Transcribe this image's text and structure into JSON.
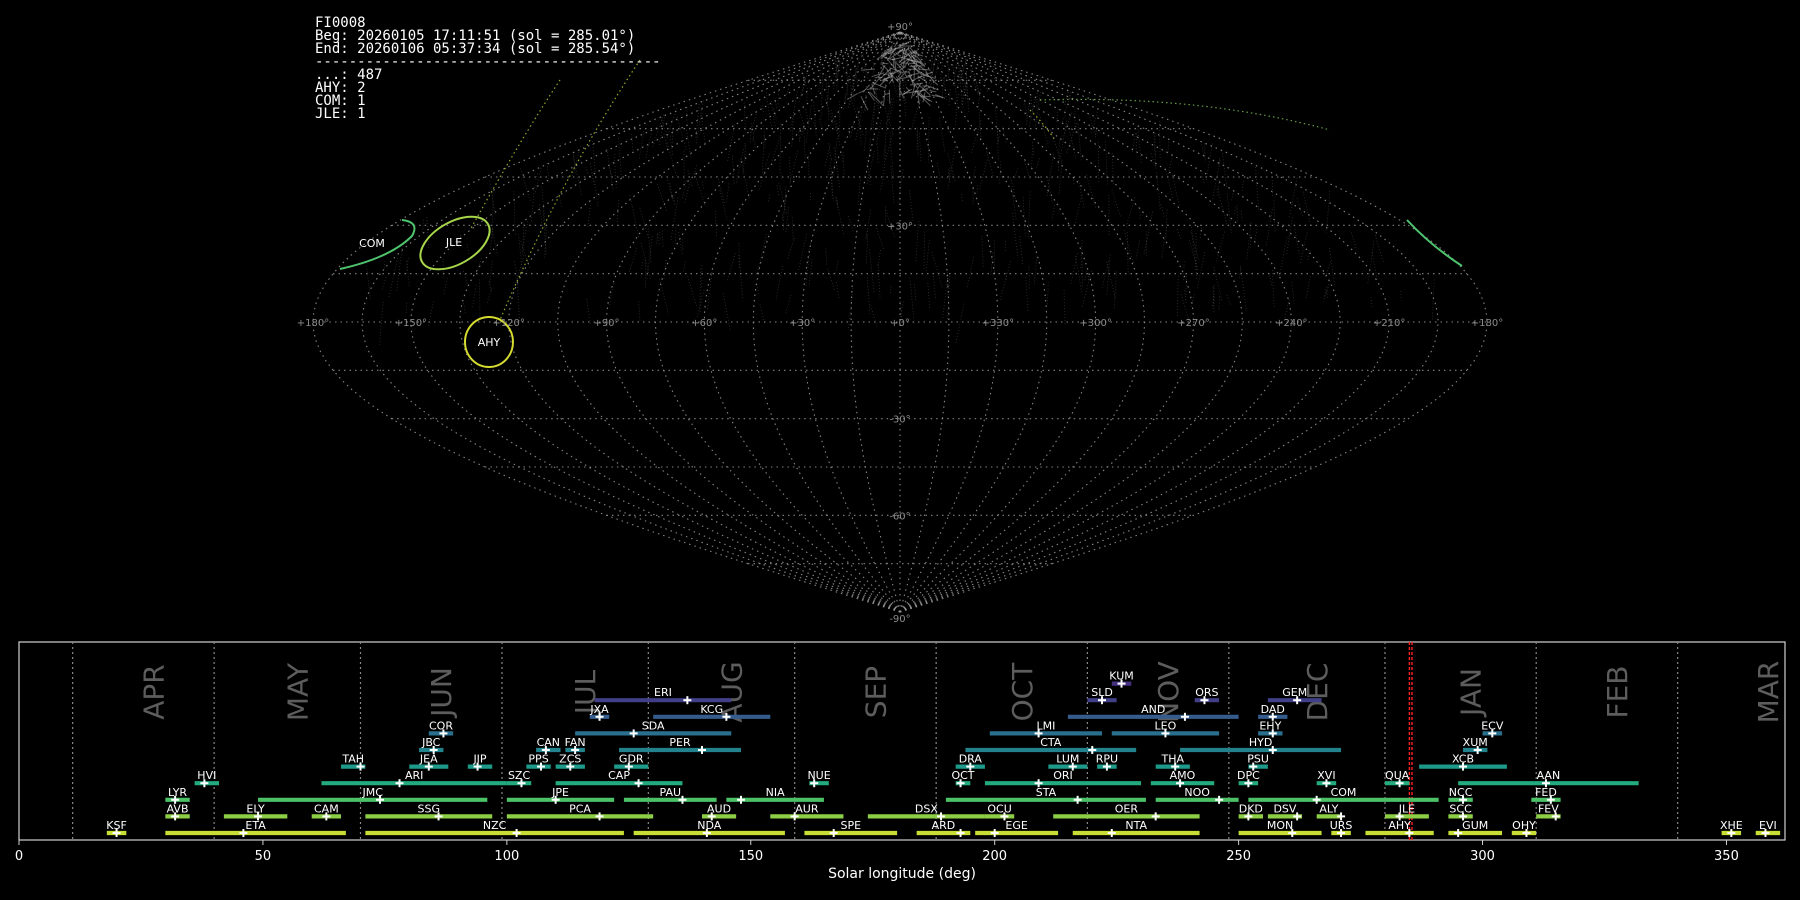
{
  "info": {
    "code": "FI0008",
    "begin": "Beg: 20260105 17:11:51 (sol = 285.01°)",
    "end": "End: 20260106 05:37:34 (sol = 285.54°)",
    "separator": "-----------------------------------------",
    "counts": [
      "...: 487",
      "AHY: 2",
      "COM: 1",
      "JLE: 1"
    ]
  },
  "sky": {
    "lon_labels": [
      "+180°",
      "+150°",
      "+120°",
      "+90°",
      "+60°",
      "+30°",
      "+0°",
      "+330°",
      "+300°",
      "+270°",
      "+240°",
      "+210°",
      "+180°"
    ],
    "lat_labels": [
      "+90°",
      "+30°",
      "-30°",
      "-60°",
      "-90°"
    ],
    "shower_labels": [
      "COM",
      "JLE",
      "AHY"
    ]
  },
  "chart_data": {
    "type": "timeline",
    "xlabel": "Solar longitude (deg)",
    "xlim": [
      0,
      362
    ],
    "xticks": [
      0,
      50,
      100,
      150,
      200,
      250,
      300,
      350
    ],
    "current_sol": [
      285.01,
      285.54
    ],
    "months": [
      {
        "label": "APR",
        "sol": 11
      },
      {
        "label": "MAY",
        "sol": 40
      },
      {
        "label": "JUN",
        "sol": 70
      },
      {
        "label": "JUL",
        "sol": 99
      },
      {
        "label": "AUG",
        "sol": 129
      },
      {
        "label": "SEP",
        "sol": 159
      },
      {
        "label": "OCT",
        "sol": 188
      },
      {
        "label": "NOV",
        "sol": 219
      },
      {
        "label": "DEC",
        "sol": 248
      },
      {
        "label": "JAN",
        "sol": 280
      },
      {
        "label": "FEB",
        "sol": 311
      },
      {
        "label": "MAR",
        "sol": 340
      }
    ],
    "showers": [
      {
        "code": "KSF",
        "start": 18,
        "end": 22,
        "peak": 20,
        "row": 0
      },
      {
        "code": "ETA",
        "start": 30,
        "end": 67,
        "peak": 46,
        "row": 0
      },
      {
        "code": "NZC",
        "start": 71,
        "end": 124,
        "peak": 102,
        "row": 0
      },
      {
        "code": "NDA",
        "start": 126,
        "end": 157,
        "peak": 141,
        "row": 0
      },
      {
        "code": "SPE",
        "start": 161,
        "end": 180,
        "peak": 167,
        "row": 0
      },
      {
        "code": "ARD",
        "start": 184,
        "end": 195,
        "peak": 193,
        "row": 0
      },
      {
        "code": "EGE",
        "start": 196,
        "end": 213,
        "peak": 200,
        "row": 0
      },
      {
        "code": "NTA",
        "start": 216,
        "end": 242,
        "peak": 224,
        "row": 0
      },
      {
        "code": "MON",
        "start": 250,
        "end": 267,
        "peak": 261,
        "row": 0
      },
      {
        "code": "URS",
        "start": 269,
        "end": 273,
        "peak": 271,
        "row": 0
      },
      {
        "code": "AHY",
        "start": 276,
        "end": 290,
        "peak": 285,
        "row": 0
      },
      {
        "code": "GUM",
        "start": 293,
        "end": 304,
        "peak": 295,
        "row": 0
      },
      {
        "code": "OHY",
        "start": 306,
        "end": 311,
        "peak": 309,
        "row": 0
      },
      {
        "code": "XHE",
        "start": 349,
        "end": 353,
        "peak": 351,
        "row": 0
      },
      {
        "code": "EVI",
        "start": 356,
        "end": 361,
        "peak": 358,
        "row": 0
      },
      {
        "code": "AVB",
        "start": 30,
        "end": 35,
        "peak": 32,
        "row": 1
      },
      {
        "code": "ELY",
        "start": 42,
        "end": 55,
        "peak": 49,
        "row": 1
      },
      {
        "code": "CAM",
        "start": 60,
        "end": 66,
        "peak": 63,
        "row": 1
      },
      {
        "code": "SSG",
        "start": 71,
        "end": 97,
        "peak": 86,
        "row": 1
      },
      {
        "code": "PCA",
        "start": 100,
        "end": 130,
        "peak": 119,
        "row": 1
      },
      {
        "code": "AUD",
        "start": 140,
        "end": 147,
        "peak": 142,
        "row": 1
      },
      {
        "code": "AUR",
        "start": 154,
        "end": 169,
        "peak": 159,
        "row": 1
      },
      {
        "code": "DSX",
        "start": 174,
        "end": 198,
        "peak": 189,
        "row": 1
      },
      {
        "code": "OCU",
        "start": 198,
        "end": 204,
        "peak": 202,
        "row": 1
      },
      {
        "code": "OER",
        "start": 212,
        "end": 242,
        "peak": 233,
        "row": 1
      },
      {
        "code": "DKD",
        "start": 250,
        "end": 255,
        "peak": 252,
        "row": 1
      },
      {
        "code": "DSV",
        "start": 256,
        "end": 263,
        "peak": 262,
        "row": 1
      },
      {
        "code": "ALY",
        "start": 266,
        "end": 271,
        "peak": 271,
        "row": 1
      },
      {
        "code": "JLE",
        "start": 280,
        "end": 289,
        "peak": 283,
        "row": 1
      },
      {
        "code": "SCC",
        "start": 293,
        "end": 298,
        "peak": 296,
        "row": 1
      },
      {
        "code": "FEV",
        "start": 311,
        "end": 316,
        "peak": 315,
        "row": 1
      },
      {
        "code": "LYR",
        "start": 30,
        "end": 35,
        "peak": 32,
        "row": 2
      },
      {
        "code": "JMC",
        "start": 49,
        "end": 96,
        "peak": 74,
        "row": 2
      },
      {
        "code": "JPE",
        "start": 100,
        "end": 122,
        "peak": 110,
        "row": 2
      },
      {
        "code": "PAU",
        "start": 124,
        "end": 143,
        "peak": 136,
        "row": 2
      },
      {
        "code": "NIA",
        "start": 145,
        "end": 165,
        "peak": 148,
        "row": 2
      },
      {
        "code": "STA",
        "start": 190,
        "end": 231,
        "peak": 217,
        "row": 2
      },
      {
        "code": "NOO",
        "start": 233,
        "end": 250,
        "peak": 246,
        "row": 2
      },
      {
        "code": "COM",
        "start": 252,
        "end": 291,
        "peak": 266,
        "row": 2
      },
      {
        "code": "NCC",
        "start": 293,
        "end": 298,
        "peak": 296,
        "row": 2
      },
      {
        "code": "FED",
        "start": 310,
        "end": 316,
        "peak": 314,
        "row": 2
      },
      {
        "code": "HVI",
        "start": 36,
        "end": 41,
        "peak": 38,
        "row": 3
      },
      {
        "code": "ARI",
        "start": 62,
        "end": 100,
        "peak": 78,
        "row": 3
      },
      {
        "code": "SZC",
        "start": 100,
        "end": 105,
        "peak": 103,
        "row": 3
      },
      {
        "code": "CAP",
        "start": 110,
        "end": 136,
        "peak": 127,
        "row": 3
      },
      {
        "code": "NUE",
        "start": 162,
        "end": 166,
        "peak": 163,
        "row": 3
      },
      {
        "code": "OCT",
        "start": 192,
        "end": 195,
        "peak": 193,
        "row": 3
      },
      {
        "code": "ORI",
        "start": 198,
        "end": 230,
        "peak": 209,
        "row": 3
      },
      {
        "code": "AMO",
        "start": 232,
        "end": 245,
        "peak": 238,
        "row": 3
      },
      {
        "code": "DPC",
        "start": 250,
        "end": 254,
        "peak": 252,
        "row": 3
      },
      {
        "code": "XVI",
        "start": 266,
        "end": 270,
        "peak": 268,
        "row": 3
      },
      {
        "code": "QUA",
        "start": 280,
        "end": 285,
        "peak": 283,
        "row": 3
      },
      {
        "code": "AAN",
        "start": 295,
        "end": 332,
        "peak": 313,
        "row": 3
      },
      {
        "code": "TAH",
        "start": 66,
        "end": 71,
        "peak": 70,
        "row": 4
      },
      {
        "code": "JEA",
        "start": 80,
        "end": 88,
        "peak": 84,
        "row": 4
      },
      {
        "code": "JIP",
        "start": 92,
        "end": 97,
        "peak": 94,
        "row": 4
      },
      {
        "code": "PPS",
        "start": 104,
        "end": 109,
        "peak": 107,
        "row": 4
      },
      {
        "code": "ZCS",
        "start": 110,
        "end": 116,
        "peak": 113,
        "row": 4
      },
      {
        "code": "GDR",
        "start": 122,
        "end": 129,
        "peak": 125,
        "row": 4
      },
      {
        "code": "DRA",
        "start": 192,
        "end": 198,
        "peak": 195,
        "row": 4
      },
      {
        "code": "LUM",
        "start": 211,
        "end": 219,
        "peak": 216,
        "row": 4
      },
      {
        "code": "RPU",
        "start": 221,
        "end": 225,
        "peak": 223,
        "row": 4
      },
      {
        "code": "THA",
        "start": 233,
        "end": 240,
        "peak": 237,
        "row": 4
      },
      {
        "code": "PSU",
        "start": 252,
        "end": 256,
        "peak": 253,
        "row": 4
      },
      {
        "code": "XCB",
        "start": 287,
        "end": 305,
        "peak": 296,
        "row": 4
      },
      {
        "code": "JBC",
        "start": 82,
        "end": 87,
        "peak": 85,
        "row": 5
      },
      {
        "code": "CAN",
        "start": 106,
        "end": 111,
        "peak": 108,
        "row": 5
      },
      {
        "code": "FAN",
        "start": 112,
        "end": 116,
        "peak": 114,
        "row": 5
      },
      {
        "code": "PER",
        "start": 123,
        "end": 148,
        "peak": 140,
        "row": 5
      },
      {
        "code": "CTA",
        "start": 194,
        "end": 229,
        "peak": 220,
        "row": 5
      },
      {
        "code": "HYD",
        "start": 238,
        "end": 271,
        "peak": 257,
        "row": 5
      },
      {
        "code": "XUM",
        "start": 296,
        "end": 301,
        "peak": 299,
        "row": 5
      },
      {
        "code": "COR",
        "start": 84,
        "end": 89,
        "peak": 87,
        "row": 6
      },
      {
        "code": "SDA",
        "start": 114,
        "end": 146,
        "peak": 126,
        "row": 6
      },
      {
        "code": "LMI",
        "start": 199,
        "end": 222,
        "peak": 209,
        "row": 6
      },
      {
        "code": "LEO",
        "start": 224,
        "end": 246,
        "peak": 235,
        "row": 6
      },
      {
        "code": "EHY",
        "start": 254,
        "end": 259,
        "peak": 257,
        "row": 6
      },
      {
        "code": "ECV",
        "start": 300,
        "end": 304,
        "peak": 302,
        "row": 6
      },
      {
        "code": "JXA",
        "start": 117,
        "end": 121,
        "peak": 119,
        "row": 7
      },
      {
        "code": "KCG",
        "start": 130,
        "end": 154,
        "peak": 145,
        "row": 7
      },
      {
        "code": "AND",
        "start": 215,
        "end": 250,
        "peak": 239,
        "row": 7
      },
      {
        "code": "DAD",
        "start": 254,
        "end": 260,
        "peak": 257,
        "row": 7
      },
      {
        "code": "ERI",
        "start": 118,
        "end": 146,
        "peak": 137,
        "row": 8
      },
      {
        "code": "SLD",
        "start": 219,
        "end": 225,
        "peak": 222,
        "row": 8
      },
      {
        "code": "ORS",
        "start": 241,
        "end": 246,
        "peak": 243,
        "row": 8
      },
      {
        "code": "GEM",
        "start": 256,
        "end": 267,
        "peak": 262,
        "row": 8
      },
      {
        "code": "KUM",
        "start": 224,
        "end": 228,
        "peak": 226,
        "row": 9
      }
    ]
  }
}
